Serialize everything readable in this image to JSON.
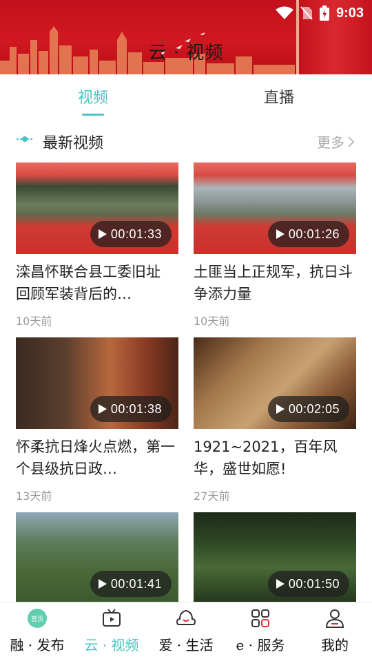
{
  "status_bar": {
    "time": "9:03"
  },
  "header": {
    "title": "云 · 视频"
  },
  "tabs": [
    {
      "label": "视频",
      "active": true
    },
    {
      "label": "直播",
      "active": false
    }
  ],
  "section": {
    "title": "最新视频",
    "more_label": "更多"
  },
  "videos": [
    {
      "title": "滦昌怀联合县工委旧址 回顾军装背后的…",
      "duration": "00:01:33",
      "time_ago": "10天前"
    },
    {
      "title": "土匪当上正规军，抗日斗争添力量",
      "duration": "00:01:26",
      "time_ago": "10天前"
    },
    {
      "title": "怀柔抗日烽火点燃，第一个县级抗日政…",
      "duration": "00:01:38",
      "time_ago": "13天前"
    },
    {
      "title": "1921~2021，百年风华，盛世如愿!",
      "duration": "00:02:05",
      "time_ago": "27天前"
    },
    {
      "title": "",
      "duration": "00:01:41",
      "time_ago": ""
    },
    {
      "title": "",
      "duration": "00:01:50",
      "time_ago": ""
    }
  ],
  "bottom_nav": [
    {
      "label": "融 · 发布",
      "icon": "home-badge-icon",
      "badge": "首页",
      "active": false
    },
    {
      "label": "云 · 视频",
      "icon": "tv-icon",
      "active": true
    },
    {
      "label": "爱 · 生活",
      "icon": "smile-cloud-icon",
      "active": false
    },
    {
      "label": "e · 服务",
      "icon": "grid-apps-icon",
      "active": false
    },
    {
      "label": "我的",
      "icon": "user-icon",
      "active": false
    }
  ],
  "colors": {
    "accent": "#49c4c2",
    "header_red": "#c4111c",
    "muted": "#999999"
  }
}
